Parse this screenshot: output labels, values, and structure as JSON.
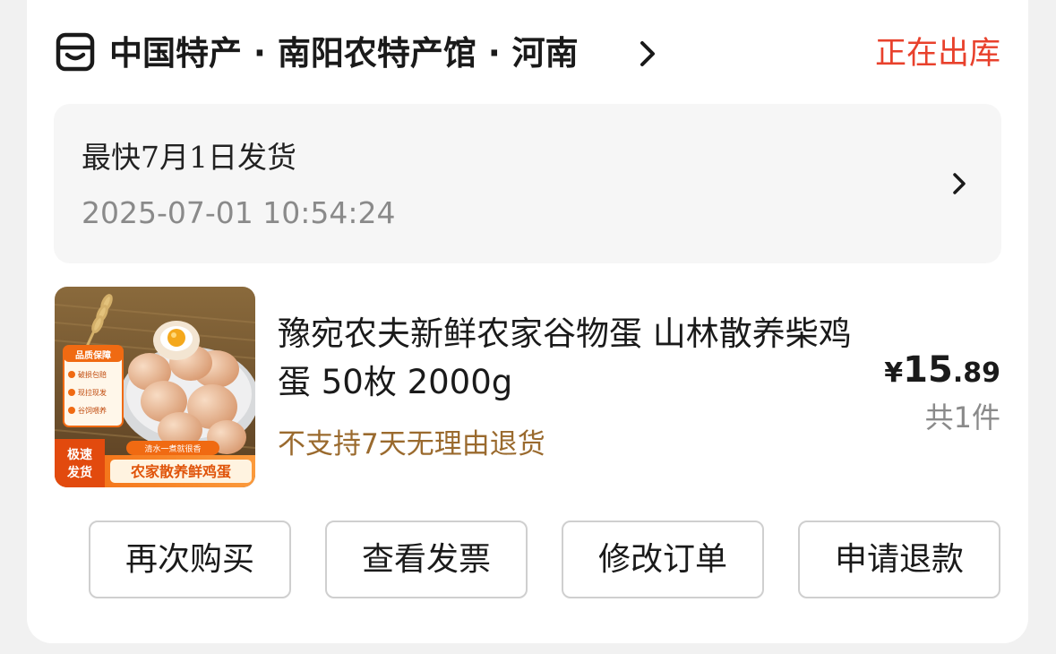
{
  "shop": {
    "name": "中国特产 · 南阳农特产馆 · 河南",
    "icon": "shop-logo-icon",
    "status": "正在出库"
  },
  "shipping": {
    "title": "最快7月1日发货",
    "time": "2025-07-01 10:54:24"
  },
  "product": {
    "title": "豫宛农夫新鲜农家谷物蛋 山林散养柴鸡蛋 50枚 2000g",
    "notice": "不支持7天无理由退货",
    "price_symbol": "¥",
    "price_int": "15",
    "price_dec": ".89",
    "quantity": "共1件",
    "thumbnail": {
      "badge_title": "品质保障",
      "badge_items": [
        "破损包赔",
        "现拉现发",
        "谷饲喂养"
      ],
      "corner_tag": [
        "极速",
        "发货"
      ],
      "slogan": "清水一煮就很香",
      "banner": "农家散养鲜鸡蛋"
    }
  },
  "actions": {
    "buy_again": "再次购买",
    "view_invoice": "查看发票",
    "modify_order": "修改订单",
    "request_refund": "申请退款"
  },
  "colors": {
    "status": "#e8412c",
    "notice": "#9a6a2e",
    "thumb_orange": "#f06a12"
  }
}
